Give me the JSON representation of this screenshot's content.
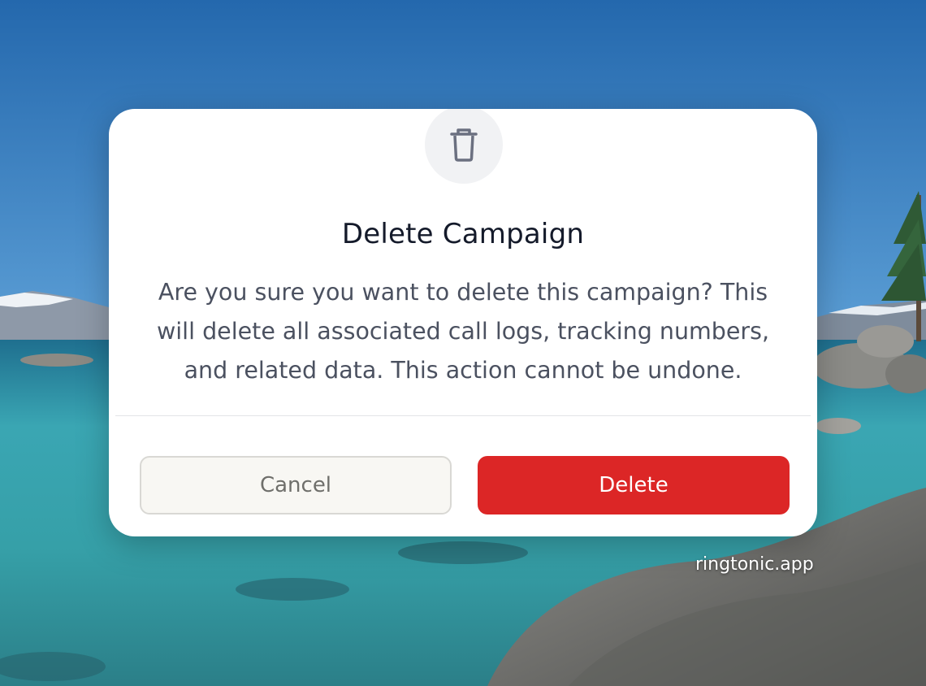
{
  "dialog": {
    "icon": "trash-icon",
    "title": "Delete Campaign",
    "message": "Are you sure you want to delete this campaign? This will delete all associated call logs, tracking numbers, and related data. This action cannot be undone.",
    "cancel_label": "Cancel",
    "delete_label": "Delete"
  },
  "watermark": "ringtonic.app",
  "colors": {
    "danger": "#dc2626",
    "title_text": "#141a2a",
    "body_text": "#4b5160"
  }
}
